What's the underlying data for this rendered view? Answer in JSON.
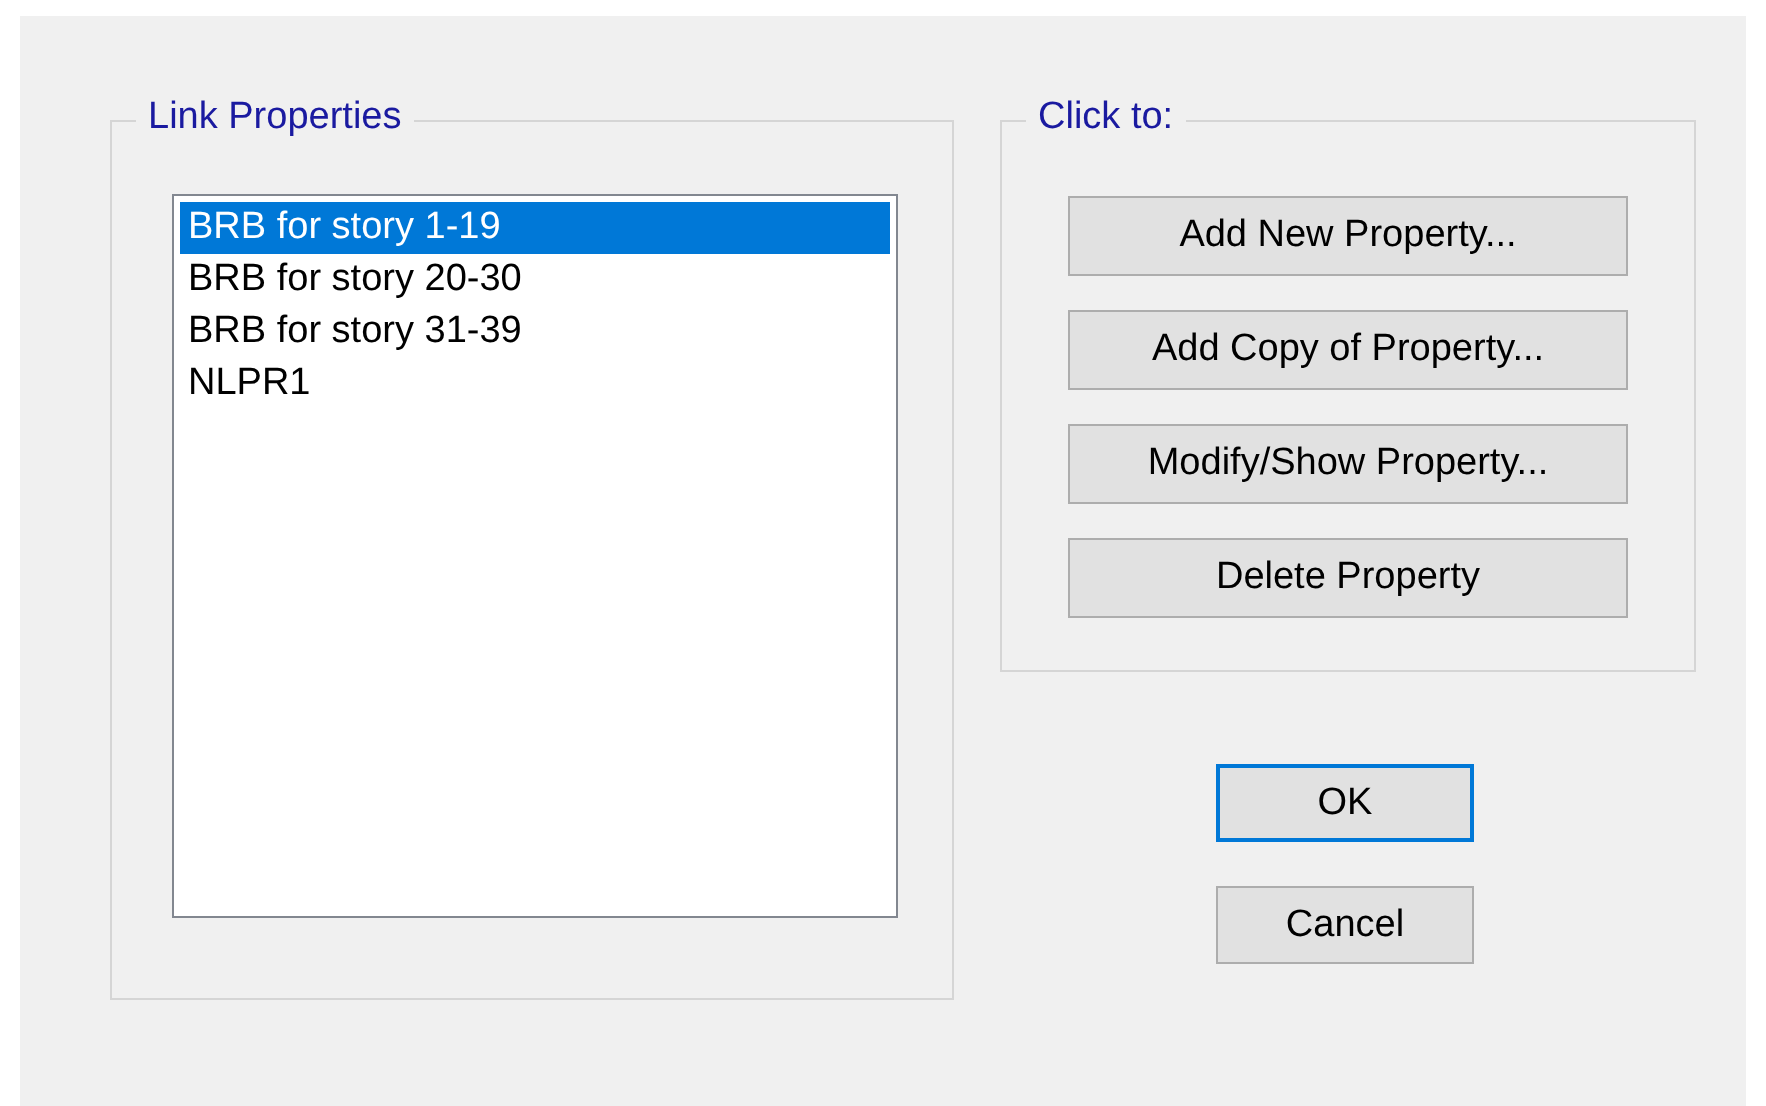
{
  "properties_group": {
    "title": "Link Properties",
    "items": [
      {
        "label": "BRB for story 1-19",
        "selected": true
      },
      {
        "label": "BRB for story 20-30",
        "selected": false
      },
      {
        "label": "BRB for story 31-39",
        "selected": false
      },
      {
        "label": "NLPR1",
        "selected": false
      }
    ]
  },
  "actions_group": {
    "title": "Click to:",
    "buttons": [
      "Add New Property...",
      "Add Copy of Property...",
      "Modify/Show Property...",
      "Delete Property"
    ]
  },
  "dialog_buttons": [
    {
      "label": "OK",
      "default": true
    },
    {
      "label": "Cancel",
      "default": false
    }
  ]
}
